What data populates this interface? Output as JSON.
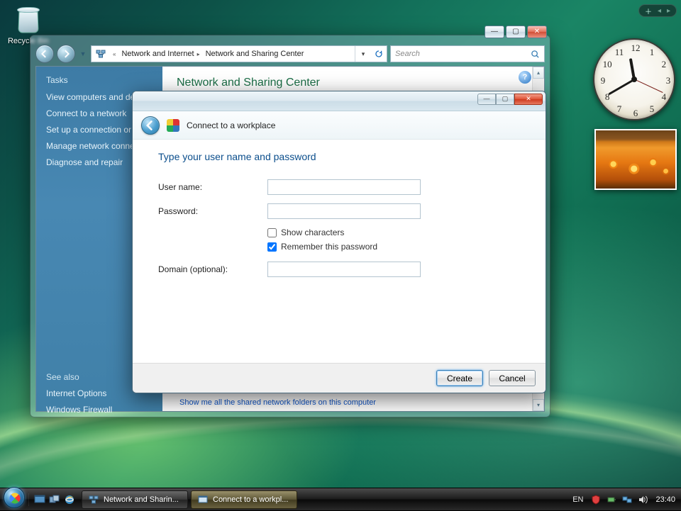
{
  "desktop": {
    "recycle_bin_label": "Recycle Bin"
  },
  "explorer": {
    "breadcrumb": {
      "seg1": "Network and Internet",
      "seg2": "Network and Sharing Center"
    },
    "search_placeholder": "Search",
    "title": "Network and Sharing Center",
    "sidebar": {
      "tasks_heading": "Tasks",
      "task1": "View computers and devices",
      "task2": "Connect to a network",
      "task3": "Set up a connection or network",
      "task4": "Manage network connections",
      "task5": "Diagnose and repair",
      "see_also_heading": "See also",
      "see1": "Internet Options",
      "see2": "Windows Firewall"
    },
    "footer_link": "Show me all the shared network folders on this computer"
  },
  "dialog": {
    "title": "Connect to a workplace",
    "heading": "Type your user name and password",
    "labels": {
      "username": "User name:",
      "password": "Password:",
      "show_chars": "Show characters",
      "remember": "Remember this password",
      "domain": "Domain (optional):"
    },
    "values": {
      "username": "",
      "password": "",
      "domain": ""
    },
    "checks": {
      "show_chars": false,
      "remember": true
    },
    "buttons": {
      "create": "Create",
      "cancel": "Cancel"
    }
  },
  "clock": {
    "numbers": [
      "12",
      "1",
      "2",
      "3",
      "4",
      "5",
      "6",
      "7",
      "8",
      "9",
      "10",
      "11"
    ],
    "hour_deg": 350,
    "minute_deg": 240,
    "second_deg": 115
  },
  "taskbar": {
    "button1": "Network and Sharin...",
    "button2": "Connect to a workpl...",
    "lang": "EN",
    "time": "23:40"
  }
}
